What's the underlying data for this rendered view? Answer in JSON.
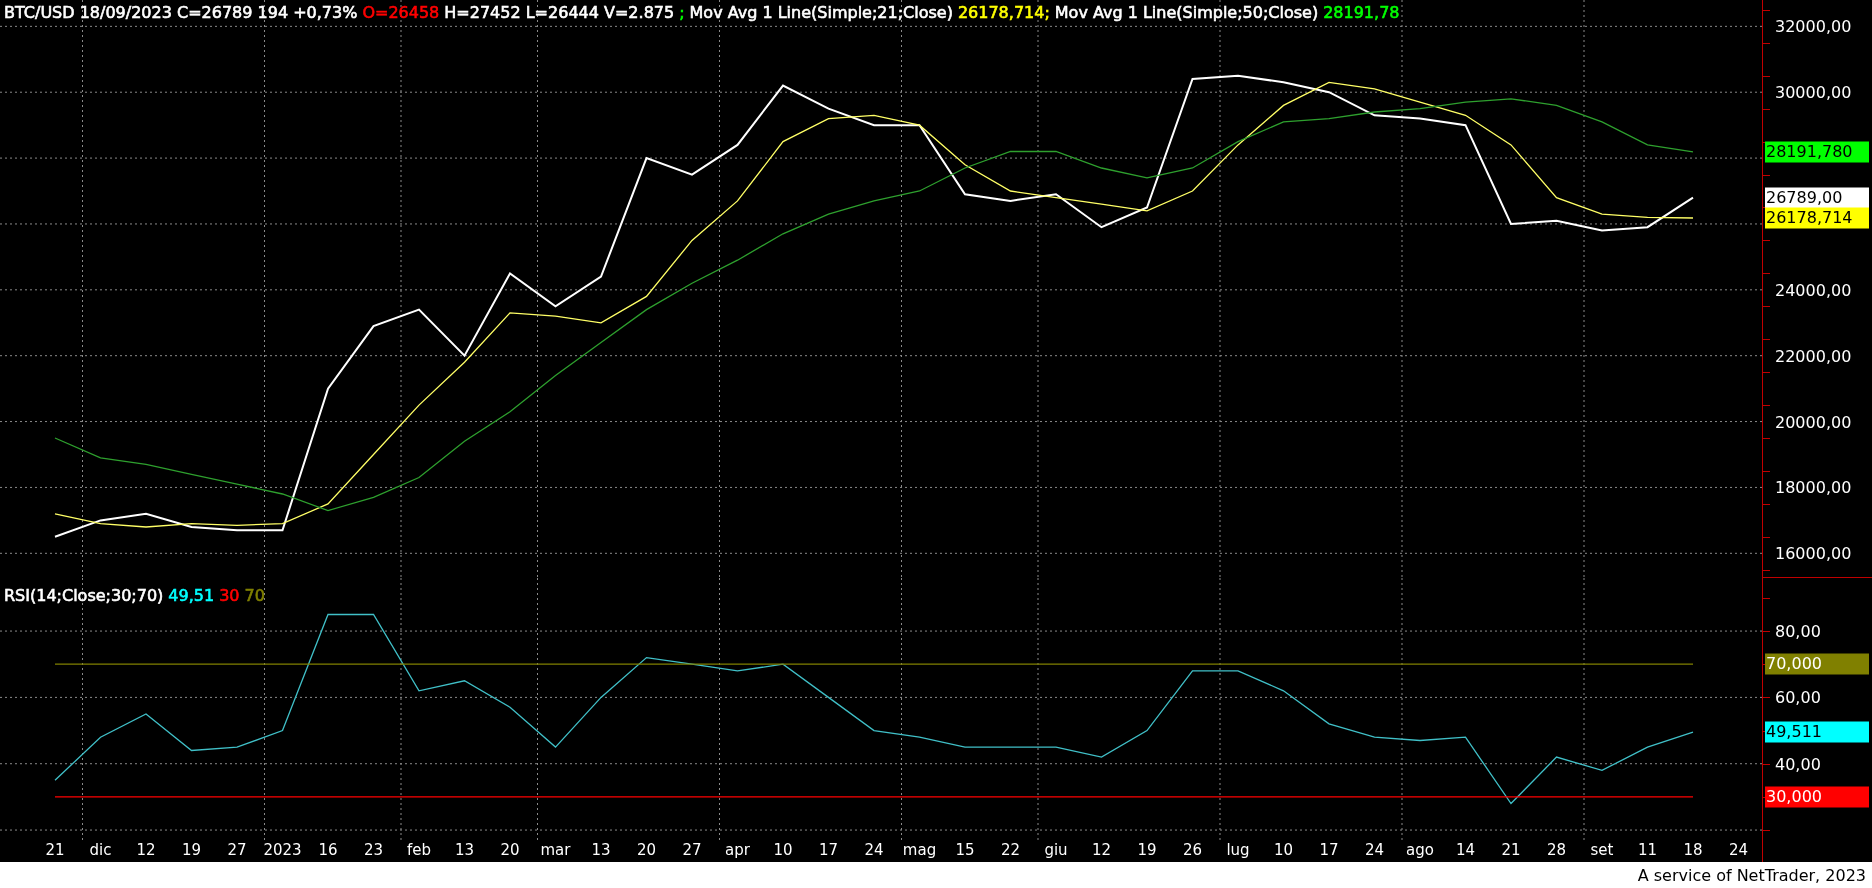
{
  "price": {
    "legend": [
      {
        "text": "BTC/USD 18/09/2023 C=26789 194 +0,73%",
        "color": "#ffffff"
      },
      {
        "text": "O=26458",
        "color": "#ff0000"
      },
      {
        "text": "H=27452 L=26444 V=2.875",
        "color": "#ffffff"
      },
      {
        "text": ";",
        "color": "#00ff00"
      },
      {
        "text": "Mov Avg 1 Line(Simple;21;Close)",
        "color": "#ffffff"
      },
      {
        "text": "26178,714;",
        "color": "#ffff00"
      },
      {
        "text": "Mov Avg 1 Line(Simple;50;Close)",
        "color": "#ffffff"
      },
      {
        "text": "28191,78",
        "color": "#00ff00"
      }
    ],
    "chart_data": {
      "type": "line",
      "grid": true,
      "series": [
        {
          "color": "#ffffff",
          "values": [
            16500,
            17000,
            17200,
            16800,
            16700,
            16700,
            21000,
            22900,
            23400,
            22000,
            24500,
            23500,
            24400,
            28000,
            27500,
            28400,
            30200,
            29500,
            29000,
            29000,
            26900,
            26700,
            26900,
            25900,
            26500,
            30400,
            30500,
            30300,
            30000,
            29300,
            29200,
            29000,
            26000,
            26100,
            25800,
            25900,
            26800,
            null
          ]
        },
        {
          "color": "#ffff66",
          "values": [
            17200,
            16900,
            16800,
            16900,
            16850,
            16900,
            17500,
            19000,
            20500,
            21800,
            23300,
            23200,
            23000,
            23800,
            25500,
            26700,
            28500,
            29200,
            29300,
            29000,
            27800,
            27000,
            26800,
            26600,
            26400,
            27000,
            28400,
            29600,
            30300,
            30100,
            29700,
            29300,
            28400,
            26800,
            26300,
            26200,
            26180,
            null
          ]
        },
        {
          "color": "#2ea02e",
          "values": [
            19500,
            18900,
            18700,
            18400,
            18100,
            17800,
            17300,
            17700,
            18300,
            19400,
            20300,
            21400,
            22400,
            23400,
            24200,
            24900,
            25700,
            26300,
            26700,
            27000,
            27700,
            28200,
            28200,
            27700,
            27400,
            27700,
            28500,
            29100,
            29200,
            29400,
            29500,
            29700,
            29800,
            29600,
            29100,
            28400,
            28190,
            null
          ]
        }
      ],
      "ylim": [
        15250,
        32800
      ],
      "yticks": [
        {
          "value": 32000,
          "label": "32000,00"
        },
        {
          "value": 30000,
          "label": "30000,00"
        },
        {
          "value": 24000,
          "label": "24000,00"
        },
        {
          "value": 22000,
          "label": "22000,00"
        },
        {
          "value": 20000,
          "label": "20000,00"
        },
        {
          "value": 18000,
          "label": "18000,00"
        },
        {
          "value": 16000,
          "label": "16000,00"
        }
      ]
    },
    "tags": [
      {
        "text": "28191,780",
        "color": "#00ff00"
      },
      {
        "text": "26789,00",
        "color": "#ffffff"
      },
      {
        "text": "26178,714",
        "color": "#ffff00"
      }
    ]
  },
  "rsi": {
    "legend": [
      {
        "text": "RSI(14;Close;30;70)",
        "color": "#ffffff"
      },
      {
        "text": "49,51",
        "color": "#00ffff"
      },
      {
        "text": "30",
        "color": "#ff0000"
      },
      {
        "text": "70",
        "color": "#808000"
      }
    ],
    "chart_data": {
      "type": "line",
      "grid": true,
      "categories": [
        "21",
        "dic",
        "12",
        "19",
        "27",
        "2023",
        "16",
        "23",
        "feb",
        "13",
        "20",
        "mar",
        "13",
        "20",
        "27",
        "apr",
        "10",
        "17",
        "24",
        "mag",
        "15",
        "22",
        "giu",
        "12",
        "19",
        "26",
        "lug",
        "10",
        "17",
        "24",
        "ago",
        "14",
        "21",
        "28",
        "set",
        "11",
        "18",
        "24"
      ],
      "series": [
        {
          "color": "#40c0c8",
          "values": [
            35,
            48,
            55,
            44,
            45,
            50,
            85,
            85,
            62,
            65,
            57,
            45,
            60,
            72,
            70,
            68,
            70,
            60,
            50,
            48,
            45,
            45,
            45,
            42,
            50,
            68,
            68,
            62,
            52,
            48,
            47,
            48,
            28,
            42,
            38,
            45,
            49.5,
            null
          ]
        },
        {
          "color": "#808000",
          "values": [
            70,
            70,
            70,
            70,
            70,
            70,
            70,
            70,
            70,
            70,
            70,
            70,
            70,
            70,
            70,
            70,
            70,
            70,
            70,
            70,
            70,
            70,
            70,
            70,
            70,
            70,
            70,
            70,
            70,
            70,
            70,
            70,
            70,
            70,
            70,
            70,
            70,
            null
          ]
        },
        {
          "color": "#ff0000",
          "values": [
            30,
            30,
            30,
            30,
            30,
            30,
            30,
            30,
            30,
            30,
            30,
            30,
            30,
            30,
            30,
            30,
            30,
            30,
            30,
            30,
            30,
            30,
            30,
            30,
            30,
            30,
            30,
            30,
            30,
            30,
            30,
            30,
            30,
            30,
            30,
            30,
            30,
            null
          ]
        }
      ],
      "ylim": [
        17,
        96
      ],
      "yticks": [
        {
          "value": 80,
          "label": "80,00"
        },
        {
          "value": 60,
          "label": "60,00"
        },
        {
          "value": 40,
          "label": "40,00"
        }
      ]
    },
    "tags": [
      {
        "text": "70,000",
        "color": "#808000"
      },
      {
        "text": "49,511",
        "color": "#00ffff"
      },
      {
        "text": "30,000",
        "color": "#ff0000"
      }
    ]
  },
  "footer": "A service of NetTrader, 2023"
}
